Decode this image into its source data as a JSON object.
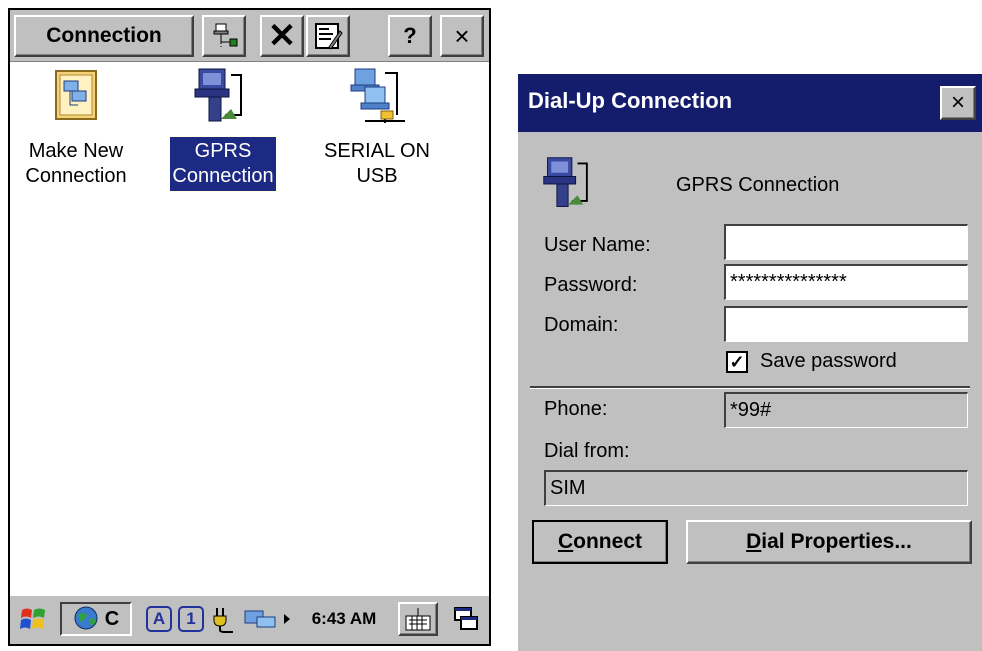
{
  "explorer": {
    "menu_title": "Connection",
    "help_label": "?",
    "close_label": "×",
    "items": [
      {
        "line1": "Make New",
        "line2": "Connection"
      },
      {
        "line1": "GPRS",
        "line2": "Connection"
      },
      {
        "line1": "SERIAL ON",
        "line2": "USB"
      }
    ]
  },
  "taskbar": {
    "running_app_label": "C",
    "input_mode_a": "A",
    "input_mode_1": "1",
    "clock": "6:43 AM"
  },
  "dialog": {
    "title": "Dial-Up Connection",
    "close_label": "×",
    "connection_name": "GPRS Connection",
    "user_name_label": "User Name:",
    "user_name_value": "",
    "password_label": "Password:",
    "password_value": "***************",
    "domain_label": "Domain:",
    "domain_value": "",
    "save_password_label": "Save password",
    "save_password_checked": true,
    "phone_label": "Phone:",
    "phone_value": "*99#",
    "dial_from_label": "Dial from:",
    "dial_from_value": "SIM",
    "connect_first": "C",
    "connect_rest": "onnect",
    "dial_props_first": "D",
    "dial_props_rest": "ial Properties..."
  },
  "colors": {
    "selection": "#1c2a84",
    "titlebar": "#141c6c",
    "chrome": "#c0c0c0"
  }
}
